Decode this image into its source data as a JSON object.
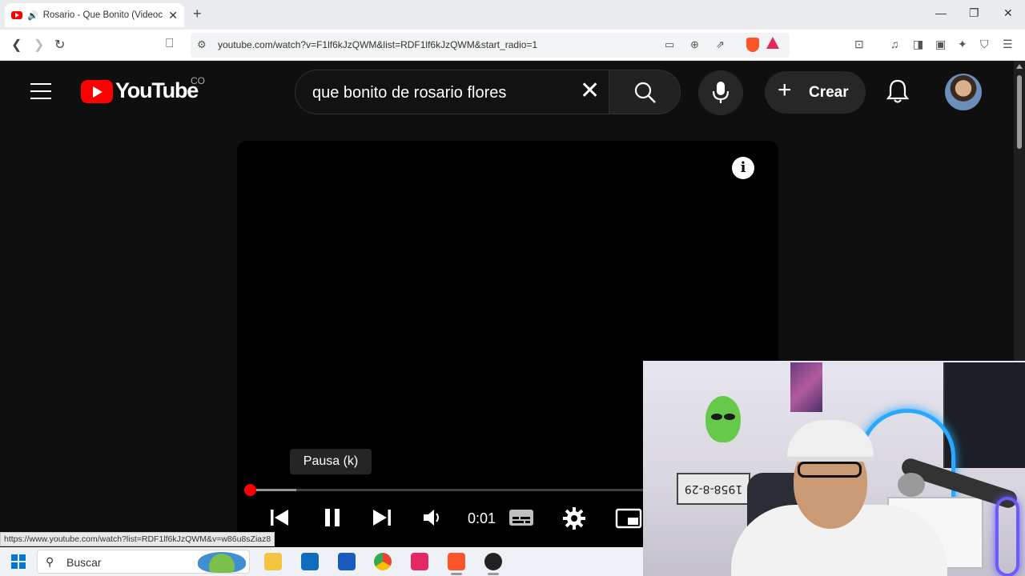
{
  "browser": {
    "tab_title": "Rosario - Que Bonito (Videoc",
    "new_tab": "+",
    "url": "youtube.com/watch?v=F1lf6kJzQWM&list=RDF1lf6kJzQWM&start_radio=1",
    "link_preview": "https://www.youtube.com/watch?list=RDF1lf6kJzQWM&v=w86u8sZiaz8"
  },
  "youtube": {
    "logo_text": "YouTube",
    "country_code": "CO",
    "search_query": "que bonito de rosario flores",
    "create_label": "Crear"
  },
  "player": {
    "tooltip": "Pausa (k)",
    "current_time": "0:01",
    "progress_played_fraction": 0.0,
    "progress_buffered_fraction": 0.09
  },
  "webcam": {
    "plate_text": "1958-8-29"
  },
  "taskbar": {
    "search_label": "Buscar"
  },
  "colors": {
    "youtube_red": "#ff0000",
    "page_bg": "#0f0f0f",
    "brave_orange": "#fb542b"
  },
  "icons": [
    "youtube-favicon",
    "speaker-icon",
    "close-icon",
    "back-icon",
    "forward-icon",
    "reload-icon",
    "bookmark-icon",
    "site-settings-icon",
    "install-icon",
    "zoom-icon",
    "share-icon",
    "brave-shield-icon",
    "brave-rewards-icon",
    "menu-icon",
    "search-icon",
    "mic-icon",
    "plus-icon",
    "bell-icon",
    "info-icon",
    "previous-icon",
    "pause-icon",
    "next-icon",
    "volume-icon",
    "subtitles-icon",
    "settings-icon",
    "miniplayer-icon",
    "windows-start-icon"
  ]
}
